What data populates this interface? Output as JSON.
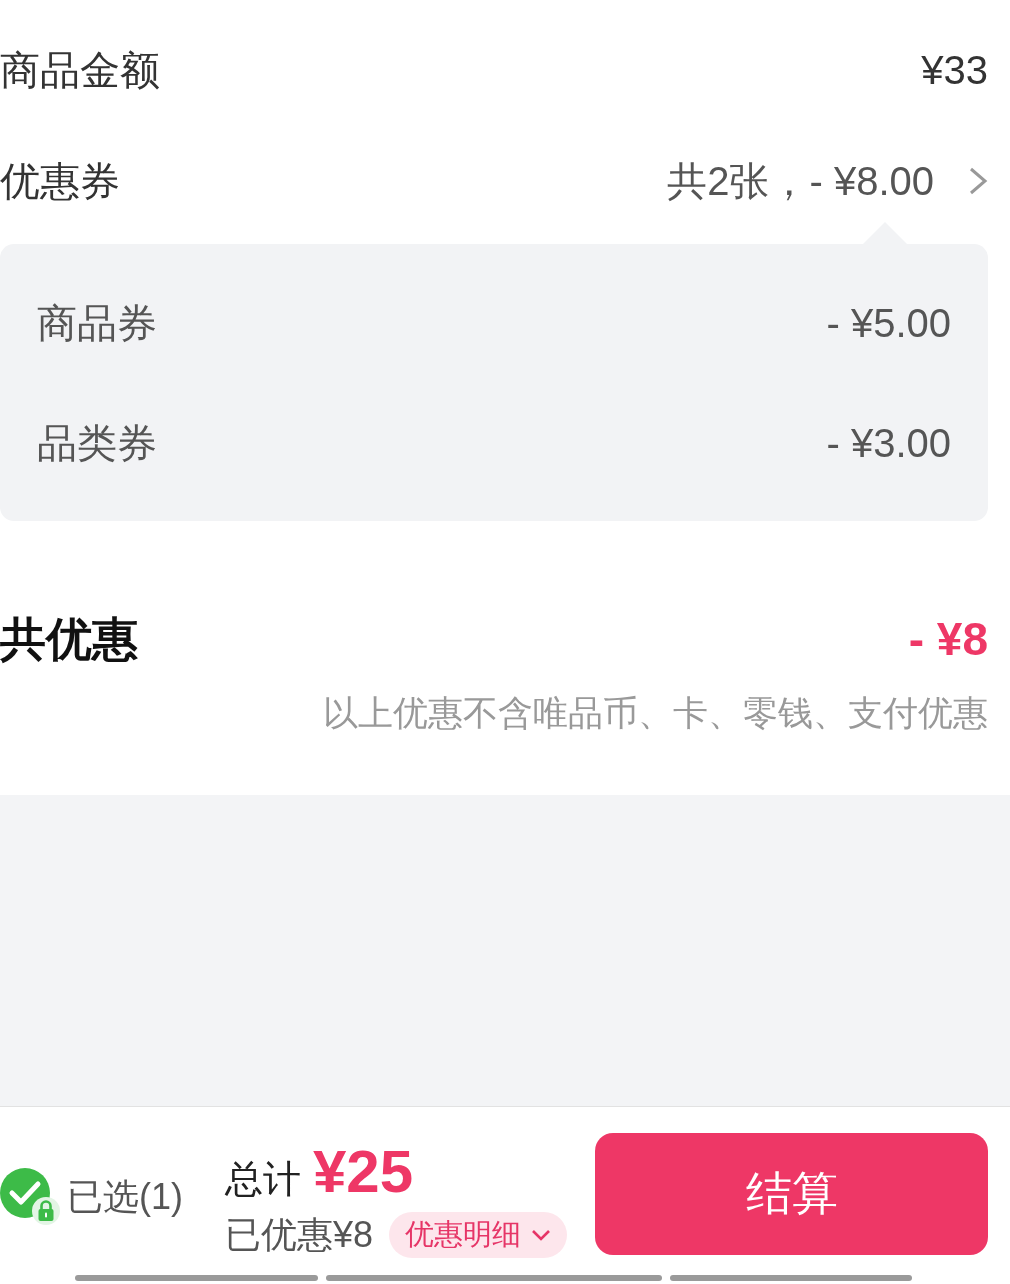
{
  "goods_amount": {
    "label": "商品金额",
    "value": "¥33"
  },
  "coupons": {
    "label": "优惠券",
    "value": "共2张，- ¥8.00",
    "expanded": true,
    "items": [
      {
        "label": "商品券",
        "value": "- ¥5.00"
      },
      {
        "label": "品类券",
        "value": "- ¥3.00"
      }
    ]
  },
  "total_discount": {
    "label": "共优惠",
    "value": "- ¥8",
    "note": "以上优惠不含唯品币、卡、零钱、支付优惠"
  },
  "bottom_bar": {
    "select": {
      "checked": true,
      "locked": true,
      "label": "已选(1)"
    },
    "total_label": "总计",
    "total_value": "¥25",
    "saved": "已优惠¥8",
    "details_button": "优惠明细",
    "checkout_button": "结算"
  }
}
